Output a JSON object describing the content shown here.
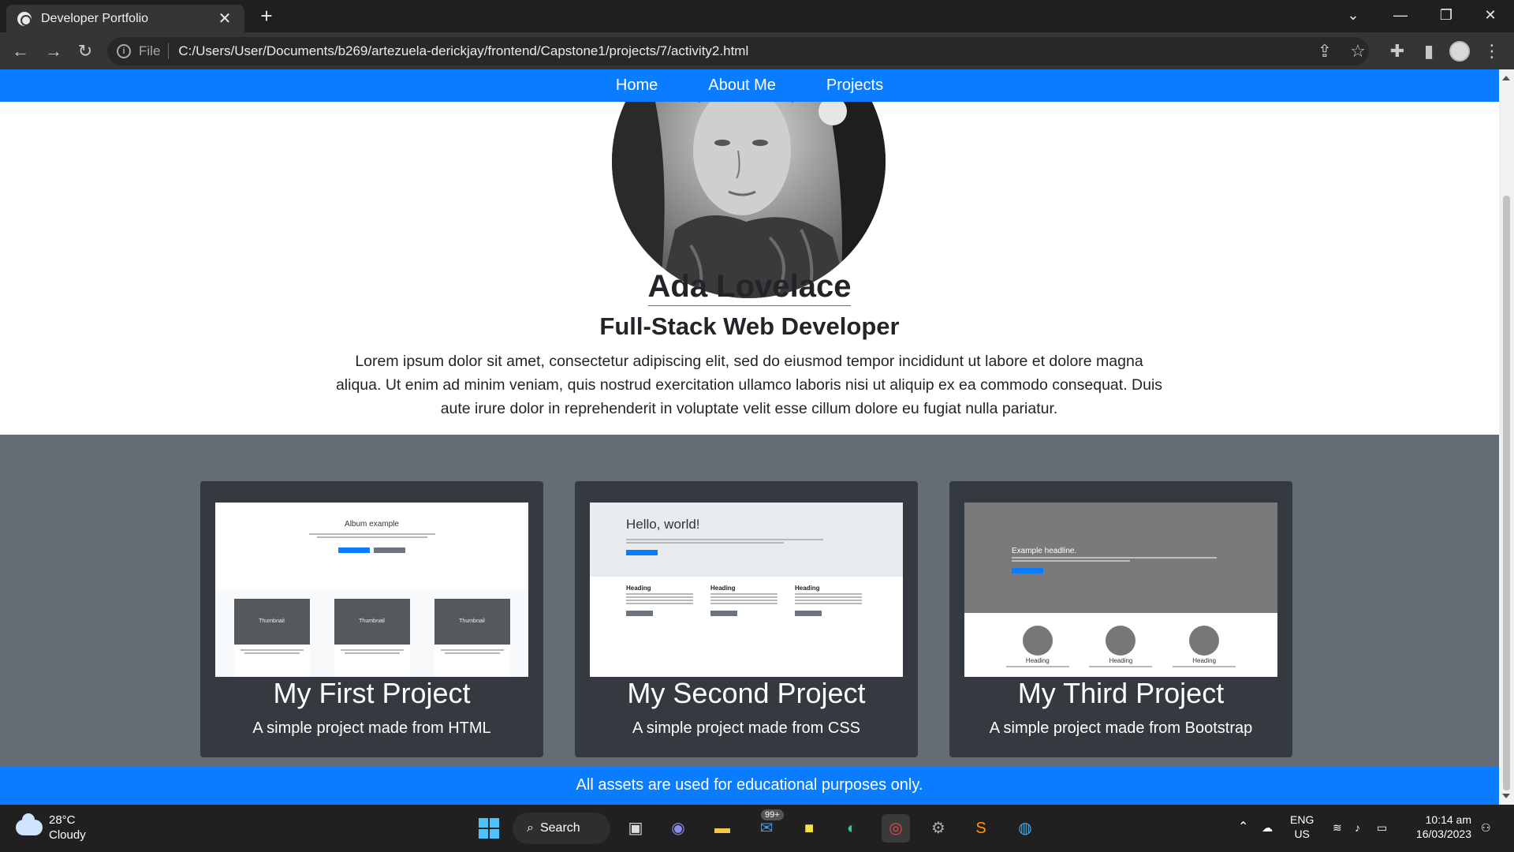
{
  "browser": {
    "tab_title": "Developer Portfolio",
    "tab_close": "✕",
    "new_tab": "+",
    "omnibox_scheme": "File",
    "omnibox_url": "C:/Users/User/Documents/b269/artezuela-derickjay/frontend/Capstone1/projects/7/activity2.html"
  },
  "site": {
    "nav": [
      "Home",
      "About Me",
      "Projects"
    ],
    "hero": {
      "name": "Ada Lovelace",
      "role": "Full-Stack Web Developer",
      "bio": "Lorem ipsum dolor sit amet, consectetur adipiscing elit, sed do eiusmod tempor incididunt ut labore et dolore magna aliqua. Ut enim ad minim veniam, quis nostrud exercitation ullamco laboris nisi ut aliquip ex ea commodo consequat. Duis aute irure dolor in reprehenderit in voluptate velit esse cillum dolore eu fugiat nulla pariatur."
    },
    "projects": [
      {
        "title": "My First Project",
        "text": "A simple project made from HTML",
        "thumb": {
          "heading": "Album example",
          "thumbnail_label": "Thumbnail"
        }
      },
      {
        "title": "My Second Project",
        "text": "A simple project made from CSS",
        "thumb": {
          "heading": "Hello, world!",
          "col_heading": "Heading"
        }
      },
      {
        "title": "My Third Project",
        "text": "A simple project made from Bootstrap",
        "thumb": {
          "heading": "Example headline.",
          "col_heading": "Heading"
        }
      }
    ],
    "footer": "All assets are used for educational purposes only."
  },
  "taskbar": {
    "weather_temp": "28°C",
    "weather_desc": "Cloudy",
    "search_label": "Search",
    "mail_badge": "99+",
    "lang": "ENG",
    "region": "US",
    "time": "10:14 am",
    "date": "16/03/2023"
  },
  "colors": {
    "nav_blue": "#0a7cff",
    "project_bg": "#646c76",
    "card_bg": "#343a40"
  }
}
